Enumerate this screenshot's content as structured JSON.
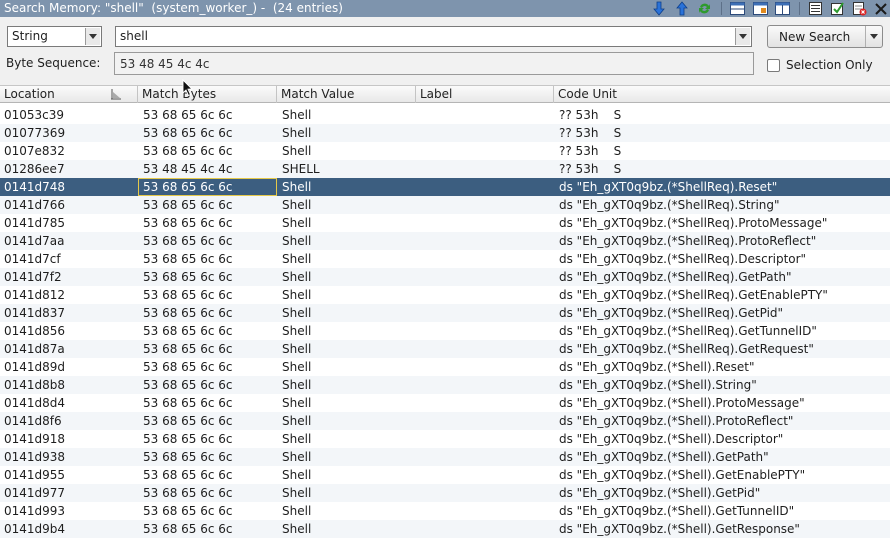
{
  "window": {
    "title": "Search Memory: \"shell\"  (system_worker_) -  (24 entries)"
  },
  "toolbar": {
    "icons": [
      "arrow-down-icon",
      "arrow-up-icon",
      "refresh-icon",
      "layout-horizontal-icon",
      "layout-nav-icon",
      "layout-split-icon",
      "list-icon",
      "select-all-icon",
      "delete-icon",
      "close-icon"
    ]
  },
  "search": {
    "format_label": "String",
    "query_value": "shell",
    "new_search_label": "New Search",
    "byte_sequence_label": "Byte Sequence:",
    "byte_sequence_value": "53 48 45 4c 4c",
    "selection_only_label": "Selection Only"
  },
  "table": {
    "columns": [
      "Location",
      "Match Bytes",
      "Match Value",
      "Label",
      "Code Unit"
    ],
    "selected_index": 4,
    "rows": [
      {
        "location": "01053c39",
        "bytes": "53 68 65 6c 6c",
        "value": "Shell",
        "label": "",
        "code": "?? 53h    S"
      },
      {
        "location": "01077369",
        "bytes": "53 68 65 6c 6c",
        "value": "Shell",
        "label": "",
        "code": "?? 53h    S"
      },
      {
        "location": "0107e832",
        "bytes": "53 68 65 6c 6c",
        "value": "Shell",
        "label": "",
        "code": "?? 53h    S"
      },
      {
        "location": "01286ee7",
        "bytes": "53 48 45 4c 4c",
        "value": "SHELL",
        "label": "",
        "code": "?? 53h    S"
      },
      {
        "location": "0141d748",
        "bytes": "53 68 65 6c 6c",
        "value": "Shell",
        "label": "",
        "code": "ds \"Eh_gXT0q9bz.(*ShellReq).Reset\""
      },
      {
        "location": "0141d766",
        "bytes": "53 68 65 6c 6c",
        "value": "Shell",
        "label": "",
        "code": "ds \"Eh_gXT0q9bz.(*ShellReq).String\""
      },
      {
        "location": "0141d785",
        "bytes": "53 68 65 6c 6c",
        "value": "Shell",
        "label": "",
        "code": "ds \"Eh_gXT0q9bz.(*ShellReq).ProtoMessage\""
      },
      {
        "location": "0141d7aa",
        "bytes": "53 68 65 6c 6c",
        "value": "Shell",
        "label": "",
        "code": "ds \"Eh_gXT0q9bz.(*ShellReq).ProtoReflect\""
      },
      {
        "location": "0141d7cf",
        "bytes": "53 68 65 6c 6c",
        "value": "Shell",
        "label": "",
        "code": "ds \"Eh_gXT0q9bz.(*ShellReq).Descriptor\""
      },
      {
        "location": "0141d7f2",
        "bytes": "53 68 65 6c 6c",
        "value": "Shell",
        "label": "",
        "code": "ds \"Eh_gXT0q9bz.(*ShellReq).GetPath\""
      },
      {
        "location": "0141d812",
        "bytes": "53 68 65 6c 6c",
        "value": "Shell",
        "label": "",
        "code": "ds \"Eh_gXT0q9bz.(*ShellReq).GetEnablePTY\""
      },
      {
        "location": "0141d837",
        "bytes": "53 68 65 6c 6c",
        "value": "Shell",
        "label": "",
        "code": "ds \"Eh_gXT0q9bz.(*ShellReq).GetPid\""
      },
      {
        "location": "0141d856",
        "bytes": "53 68 65 6c 6c",
        "value": "Shell",
        "label": "",
        "code": "ds \"Eh_gXT0q9bz.(*ShellReq).GetTunnelID\""
      },
      {
        "location": "0141d87a",
        "bytes": "53 68 65 6c 6c",
        "value": "Shell",
        "label": "",
        "code": "ds \"Eh_gXT0q9bz.(*ShellReq).GetRequest\""
      },
      {
        "location": "0141d89d",
        "bytes": "53 68 65 6c 6c",
        "value": "Shell",
        "label": "",
        "code": "ds \"Eh_gXT0q9bz.(*Shell).Reset\""
      },
      {
        "location": "0141d8b8",
        "bytes": "53 68 65 6c 6c",
        "value": "Shell",
        "label": "",
        "code": "ds \"Eh_gXT0q9bz.(*Shell).String\""
      },
      {
        "location": "0141d8d4",
        "bytes": "53 68 65 6c 6c",
        "value": "Shell",
        "label": "",
        "code": "ds \"Eh_gXT0q9bz.(*Shell).ProtoMessage\""
      },
      {
        "location": "0141d8f6",
        "bytes": "53 68 65 6c 6c",
        "value": "Shell",
        "label": "",
        "code": "ds \"Eh_gXT0q9bz.(*Shell).ProtoReflect\""
      },
      {
        "location": "0141d918",
        "bytes": "53 68 65 6c 6c",
        "value": "Shell",
        "label": "",
        "code": "ds \"Eh_gXT0q9bz.(*Shell).Descriptor\""
      },
      {
        "location": "0141d938",
        "bytes": "53 68 65 6c 6c",
        "value": "Shell",
        "label": "",
        "code": "ds \"Eh_gXT0q9bz.(*Shell).GetPath\""
      },
      {
        "location": "0141d955",
        "bytes": "53 68 65 6c 6c",
        "value": "Shell",
        "label": "",
        "code": "ds \"Eh_gXT0q9bz.(*Shell).GetEnablePTY\""
      },
      {
        "location": "0141d977",
        "bytes": "53 68 65 6c 6c",
        "value": "Shell",
        "label": "",
        "code": "ds \"Eh_gXT0q9bz.(*Shell).GetPid\""
      },
      {
        "location": "0141d993",
        "bytes": "53 68 65 6c 6c",
        "value": "Shell",
        "label": "",
        "code": "ds \"Eh_gXT0q9bz.(*Shell).GetTunnelID\""
      },
      {
        "location": "0141d9b4",
        "bytes": "53 68 65 6c 6c",
        "value": "Shell",
        "label": "",
        "code": "ds \"Eh_gXT0q9bz.(*Shell).GetResponse\""
      }
    ]
  },
  "colors": {
    "titlebar": "#7e94ad",
    "selected_row": "#3c5e80",
    "selected_cell_border": "#e5c94a"
  }
}
